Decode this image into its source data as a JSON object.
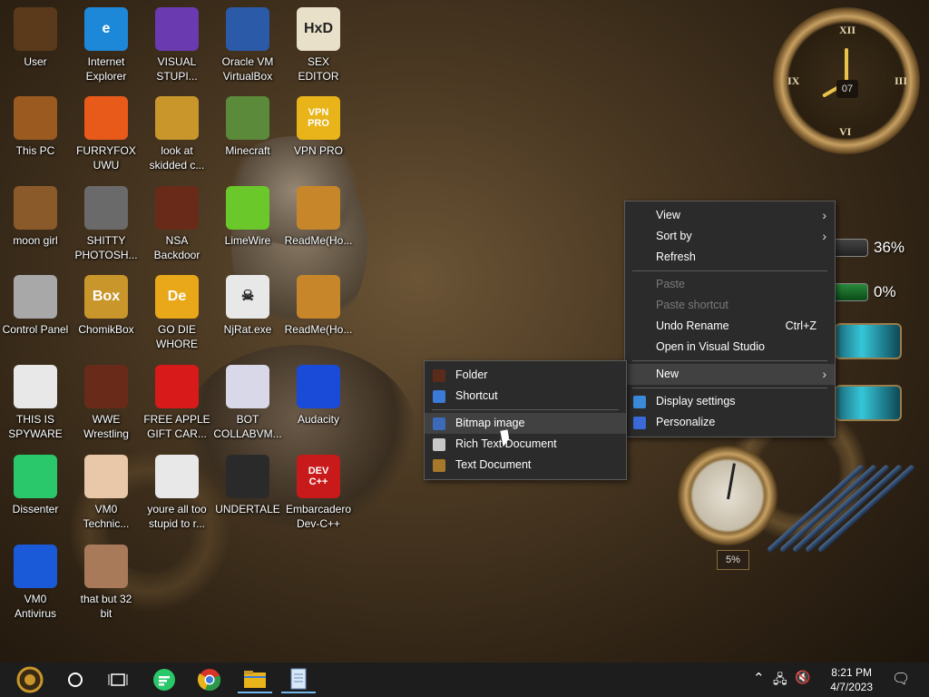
{
  "desktop_icons": [
    {
      "label": "User",
      "color": "#5a3a1a",
      "glyph": ""
    },
    {
      "label": "Internet\nExplorer",
      "color": "#1e88d8",
      "glyph": "e"
    },
    {
      "label": "VISUAL\nSTUPI...",
      "color": "#6a3ab0",
      "glyph": ""
    },
    {
      "label": "Oracle VM\nVirtualBox",
      "color": "#2a5aa8",
      "glyph": ""
    },
    {
      "label": "SEX\nEDITOR",
      "color": "#e8e0c8",
      "glyph": "HxD"
    },
    {
      "label": "This PC",
      "color": "#9a5a20",
      "glyph": ""
    },
    {
      "label": "FURRYFOX\nUWU",
      "color": "#e85a1a",
      "glyph": ""
    },
    {
      "label": "look at\nskidded c...",
      "color": "#c8962a",
      "glyph": ""
    },
    {
      "label": "Minecraft",
      "color": "#5a8a3a",
      "glyph": ""
    },
    {
      "label": "VPN PRO",
      "color": "#e8b41a",
      "glyph": "VPN\nPRO"
    },
    {
      "label": "moon girl",
      "color": "#8a5a2a",
      "glyph": ""
    },
    {
      "label": "SHITTY\nPHOTOSH...",
      "color": "#6a6a6a",
      "glyph": ""
    },
    {
      "label": "NSA\nBackdoor",
      "color": "#6a2a1a",
      "glyph": ""
    },
    {
      "label": "LimeWire",
      "color": "#6ac82a",
      "glyph": ""
    },
    {
      "label": "ReadMe(Ho...",
      "color": "#c8862a",
      "glyph": ""
    },
    {
      "label": "Control Panel",
      "color": "#a8a8a8",
      "glyph": ""
    },
    {
      "label": "ChomikBox",
      "color": "#c8962a",
      "glyph": "Box"
    },
    {
      "label": "GO DIE\nWHORE",
      "color": "#e8a81a",
      "glyph": "De"
    },
    {
      "label": "NjRat.exe",
      "color": "#e8e8e8",
      "glyph": "☠"
    },
    {
      "label": "ReadMe(Ho...",
      "color": "#c8862a",
      "glyph": ""
    },
    {
      "label": "THIS IS\nSPYWARE",
      "color": "#e8e8e8",
      "glyph": ""
    },
    {
      "label": "WWE\nWrestling",
      "color": "#6a2a1a",
      "glyph": ""
    },
    {
      "label": "FREE APPLE\nGIFT CAR...",
      "color": "#d81a1a",
      "glyph": ""
    },
    {
      "label": "BOT\nCOLLABVM...",
      "color": "#d8d8e8",
      "glyph": ""
    },
    {
      "label": "Audacity",
      "color": "#1a4ad8",
      "glyph": ""
    },
    {
      "label": "Dissenter",
      "color": "#2ac86a",
      "glyph": ""
    },
    {
      "label": "VM0\nTechnic...",
      "color": "#e8c8a8",
      "glyph": ""
    },
    {
      "label": "youre all too\nstupid to r...",
      "color": "#e8e8e8",
      "glyph": ""
    },
    {
      "label": "UNDERTALE",
      "color": "#2a2a2a",
      "glyph": ""
    },
    {
      "label": "Embarcadero\nDev-C++",
      "color": "#c81a1a",
      "glyph": "DEV\nC++"
    },
    {
      "label": "VM0\nAntivirus",
      "color": "#1a5ad8",
      "glyph": ""
    },
    {
      "label": "that but 32\nbit",
      "color": "#a87a5a",
      "glyph": ""
    }
  ],
  "gadgets": {
    "clock_numerals": [
      "XII",
      "III",
      "VI",
      "IX"
    ],
    "clock_date": "07",
    "cpu_meter": "36%",
    "ram_meter": "0%",
    "gauge_value": "5%"
  },
  "context_menu": {
    "items": [
      {
        "label": "View",
        "type": "submenu",
        "state": "normal"
      },
      {
        "label": "Sort by",
        "type": "submenu",
        "state": "normal"
      },
      {
        "label": "Refresh",
        "type": "item",
        "state": "normal"
      },
      {
        "type": "separator"
      },
      {
        "label": "Paste",
        "type": "item",
        "state": "disabled"
      },
      {
        "label": "Paste shortcut",
        "type": "item",
        "state": "disabled"
      },
      {
        "label": "Undo Rename",
        "type": "item",
        "state": "normal",
        "shortcut": "Ctrl+Z"
      },
      {
        "label": "Open in Visual Studio",
        "type": "item",
        "state": "normal"
      },
      {
        "type": "separator"
      },
      {
        "label": "New",
        "type": "submenu",
        "state": "highlight"
      },
      {
        "type": "separator"
      },
      {
        "label": "Display settings",
        "type": "item",
        "state": "normal",
        "icon_color": "#3a8ad8"
      },
      {
        "label": "Personalize",
        "type": "item",
        "state": "normal",
        "icon_color": "#3a6ad8"
      }
    ]
  },
  "new_submenu": {
    "items": [
      {
        "label": "Folder",
        "icon_color": "#5a2a1a",
        "state": "normal"
      },
      {
        "label": "Shortcut",
        "icon_color": "#3a7ad8",
        "state": "normal"
      },
      {
        "type": "separator"
      },
      {
        "label": "Bitmap image",
        "icon_color": "#3a6ab8",
        "state": "highlight"
      },
      {
        "label": "Rich Text Document",
        "icon_color": "#c8c8c8",
        "state": "normal"
      },
      {
        "label": "Text Document",
        "icon_color": "#a8782a",
        "state": "normal"
      }
    ]
  },
  "taskbar": {
    "time": "8:21 PM",
    "date": "4/7/2023",
    "start_color": "#c8962a",
    "pinned": [
      {
        "name": "search",
        "color": "#ffffff"
      },
      {
        "name": "task-view",
        "color": "#ffffff"
      },
      {
        "name": "dissenter",
        "color": "#2ac86a"
      },
      {
        "name": "chrome",
        "color": "#e8b41a"
      },
      {
        "name": "file-explorer",
        "color": "#e8b41a"
      },
      {
        "name": "notepad",
        "color": "#d8e8f8"
      }
    ]
  }
}
